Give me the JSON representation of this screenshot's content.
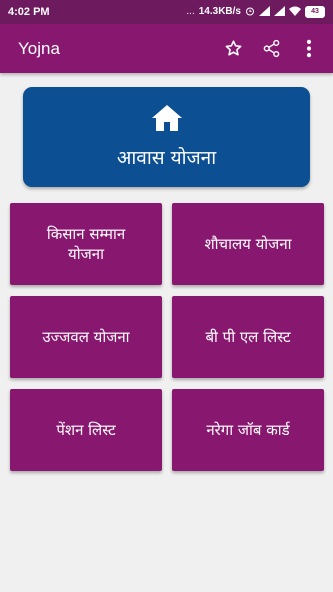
{
  "status_bar": {
    "time": "4:02 PM",
    "dots": "...",
    "network_speed": "14.3KB/s",
    "battery": "43"
  },
  "app_bar": {
    "title": "Yojna",
    "icons": [
      "star-icon",
      "share-icon",
      "overflow-menu-icon"
    ]
  },
  "colors": {
    "status_bar": "#6d1b5e",
    "app_bar": "#88186f",
    "banner": "#0c4f93",
    "tile": "#88186f",
    "background": "#f1f0f1"
  },
  "banner": {
    "label": "आवास योजना",
    "icon": "home-icon"
  },
  "tiles": [
    {
      "label": "किसान सम्मान योजना"
    },
    {
      "label": "शौचालय योजना"
    },
    {
      "label": "उज्जवल योजना"
    },
    {
      "label": "बी पी एल लिस्ट"
    },
    {
      "label": "पेंशन लिस्ट"
    },
    {
      "label": "नरेगा जॉब कार्ड"
    }
  ]
}
